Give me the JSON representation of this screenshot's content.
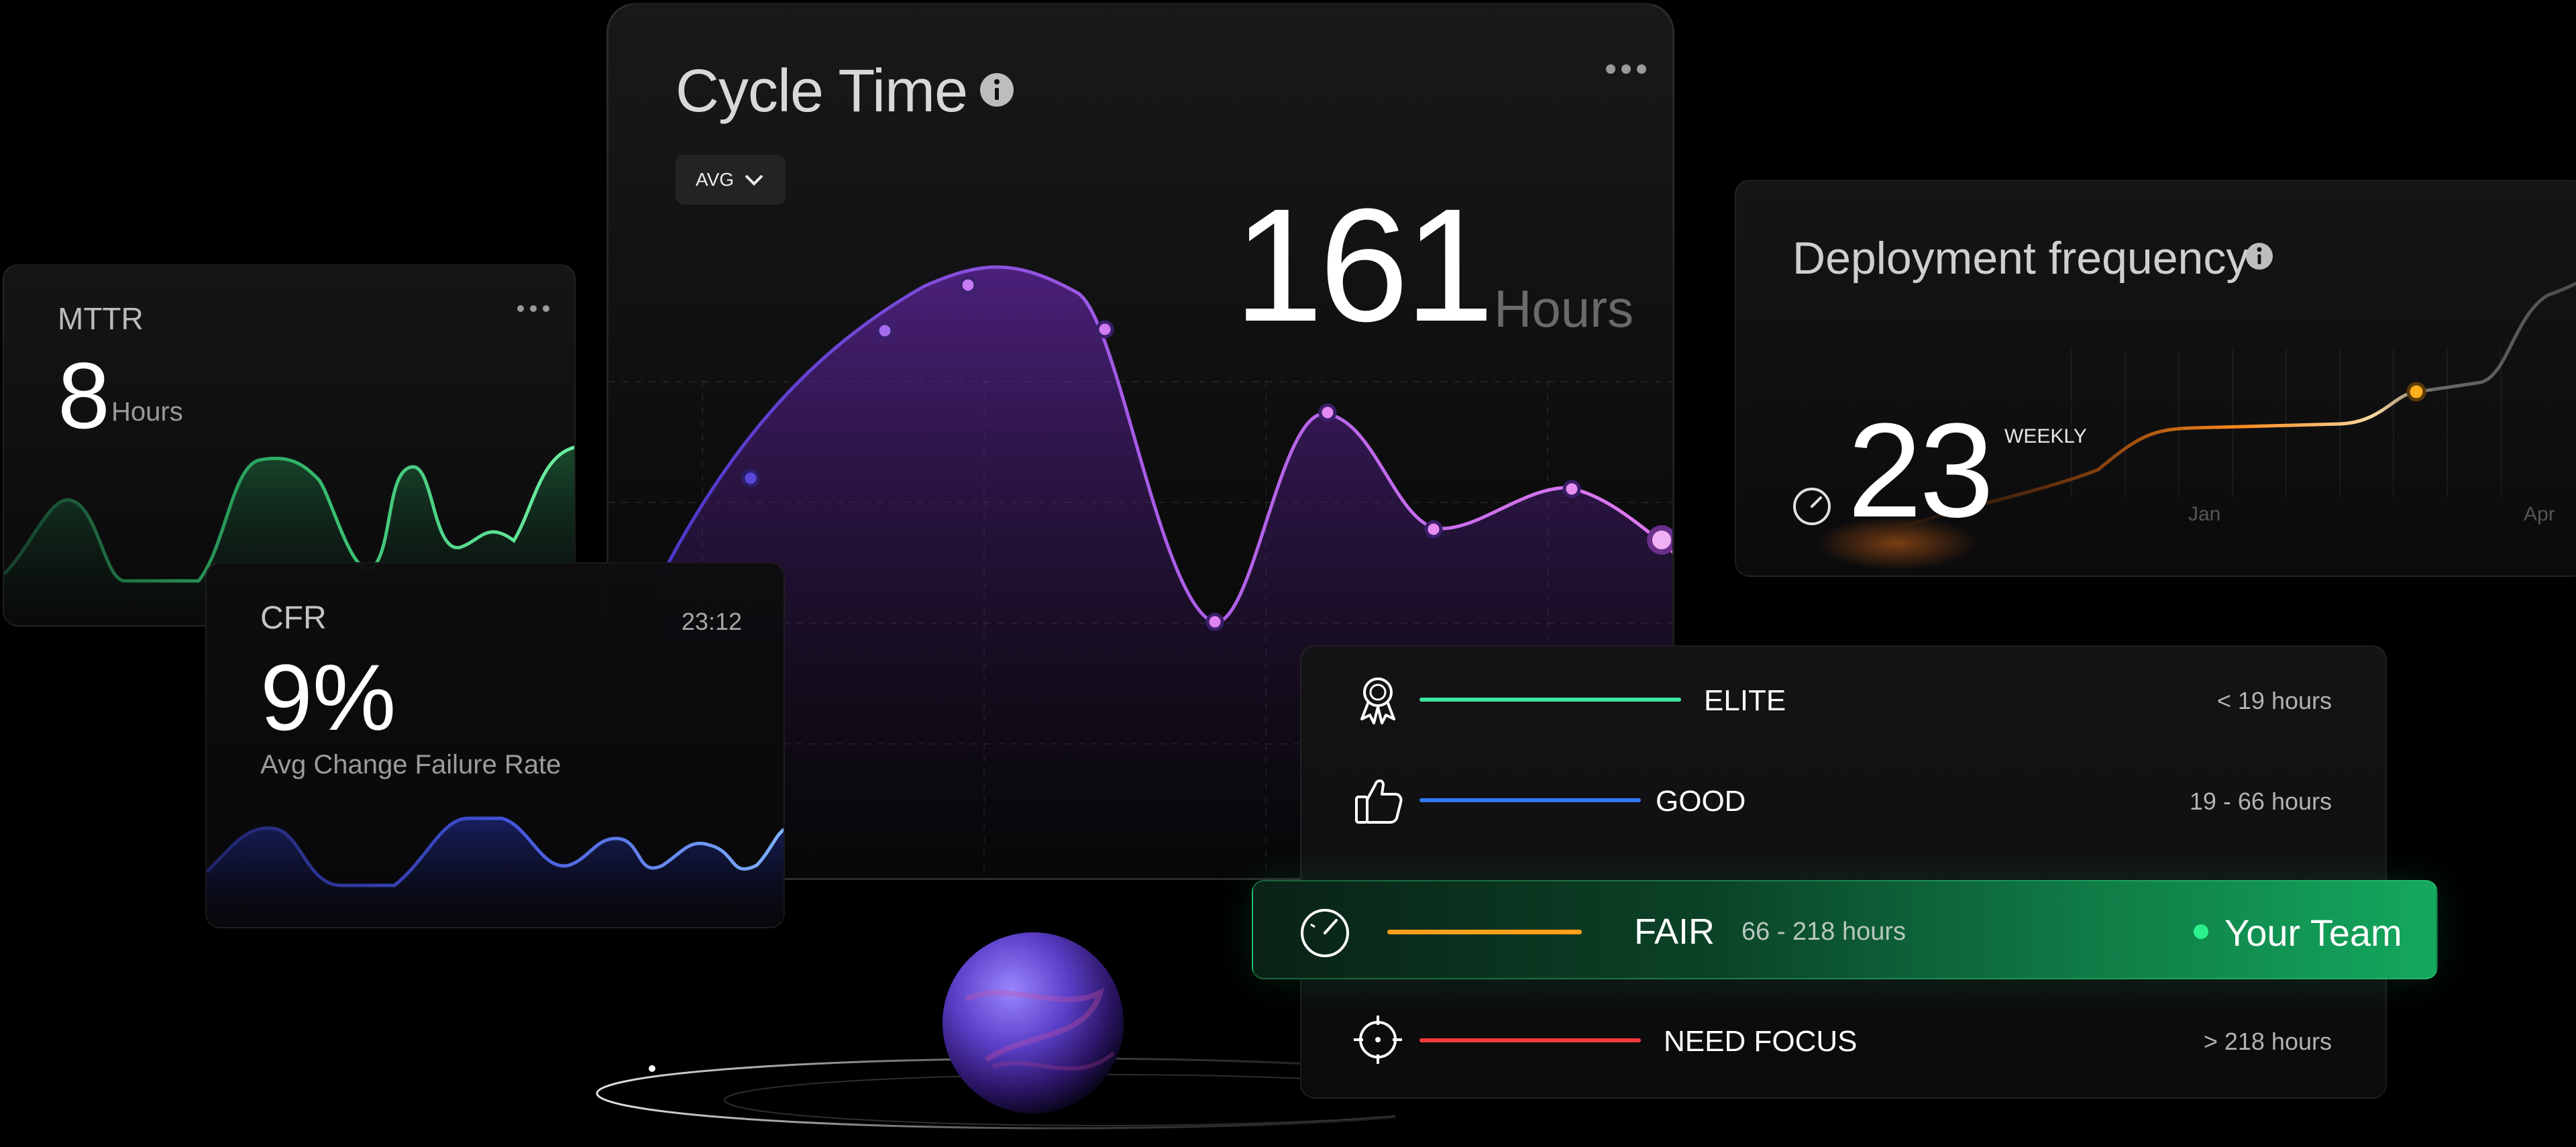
{
  "cycle_time": {
    "title": "Cycle Time",
    "aggregation": "AVG",
    "value": "161",
    "unit": "Hours"
  },
  "mttr": {
    "title": "MTTR",
    "value": "8",
    "unit": "Hours"
  },
  "cfr": {
    "title": "CFR",
    "time": "23:12",
    "value": "9%",
    "subtitle": "Avg Change Failure Rate"
  },
  "deployment": {
    "title": "Deployment frequency",
    "value": "23",
    "period": "WEEKLY",
    "x_labels": [
      "Jan",
      "Apr"
    ]
  },
  "benchmark": {
    "rows": [
      {
        "label": "ELITE",
        "range": "< 19 hours",
        "icon": "award-icon",
        "color": "#3ee6a0"
      },
      {
        "label": "GOOD",
        "range": "19 - 66  hours",
        "icon": "thumbs-up-icon",
        "color": "#2f7bff"
      },
      {
        "label": "FAIR",
        "range": "66 - 218  hours",
        "icon": "gauge-icon",
        "color": "#ff9f1c",
        "badge": "Your Team"
      },
      {
        "label": "NEED FOCUS",
        "range": "> 218 hours",
        "icon": "target-icon",
        "color": "#ff3b3b"
      }
    ]
  },
  "colors": {
    "cycle_line": "#c465f0",
    "mttr_line": "#4fe08a",
    "cfr_line": "#4f6bf2",
    "deploy_line": "#ff8a1c",
    "your_team_green": "#14a85e"
  }
}
